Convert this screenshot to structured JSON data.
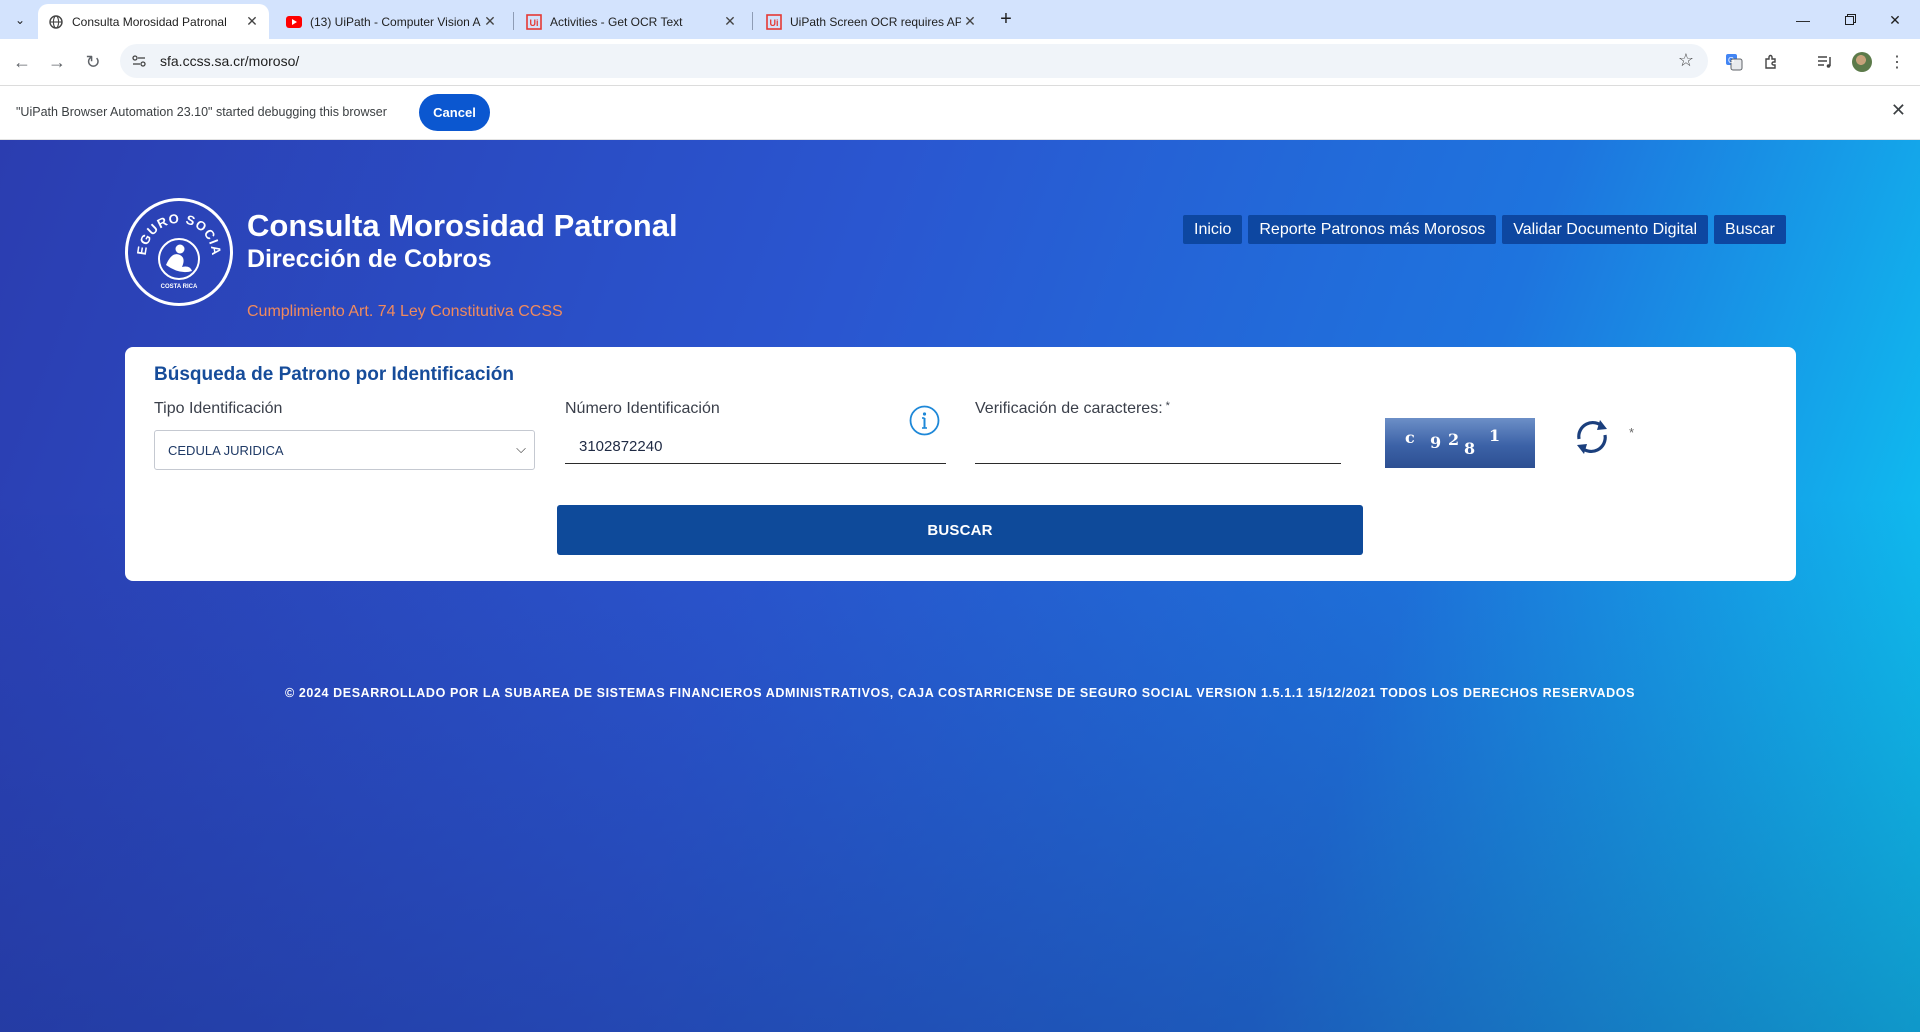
{
  "browser": {
    "tabs": [
      {
        "title": "Consulta Morosidad Patronal",
        "favicon": "globe-icon",
        "active": true
      },
      {
        "title": "(13) UiPath - Computer Vision A",
        "favicon": "youtube-icon",
        "active": false
      },
      {
        "title": "Activities - Get OCR Text",
        "favicon": "uipath-icon",
        "active": false
      },
      {
        "title": "UiPath Screen OCR requires API",
        "favicon": "uipath-icon",
        "active": false
      }
    ],
    "url": "sfa.ccss.sa.cr/moroso/",
    "colors": {
      "tabstrip": "#d3e3fd",
      "accent": "#0b57d0"
    }
  },
  "infobar": {
    "message": "\"UiPath Browser Automation 23.10\" started debugging this browser",
    "cancel_label": "Cancel"
  },
  "header": {
    "title": "Consulta Morosidad Patronal",
    "subtitle": "Dirección de Cobros",
    "tagline": "Cumplimiento Art. 74 Ley Constitutiva CCSS",
    "logo_text": "SEGURO SOCIAL",
    "logo_subtext": "COSTA RICA",
    "nav": [
      "Inicio",
      "Reporte Patronos más Morosos",
      "Validar Documento Digital",
      "Buscar"
    ]
  },
  "form": {
    "title": "Búsqueda de Patrono por Identificación",
    "tipo_label": "Tipo Identificación",
    "tipo_value": "CEDULA JURIDICA",
    "numero_label": "Número Identificación",
    "numero_value": "3102872240",
    "verificacion_label": "Verificación de caracteres:",
    "verificacion_value": "",
    "required_mark": "*",
    "captcha_chars": [
      "c",
      "9",
      "2",
      "8",
      "1"
    ],
    "submit_label": "BUSCAR"
  },
  "footer": {
    "text": "© 2024 DESARROLLADO POR LA SUBAREA DE SISTEMAS FINANCIEROS ADMINISTRATIVOS, CAJA COSTARRICENSE DE SEGURO SOCIAL VERSION 1.5.1.1 15/12/2021 TODOS LOS DERECHOS RESERVADOS"
  }
}
